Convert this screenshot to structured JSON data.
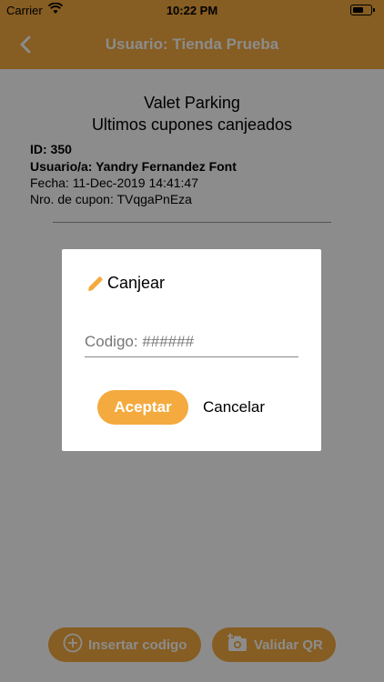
{
  "status_bar": {
    "carrier": "Carrier",
    "time": "10:22 PM"
  },
  "nav": {
    "title": "Usuario: Tienda Prueba",
    "back_icon": "chevron-left-icon"
  },
  "content": {
    "heading": "Valet Parking",
    "subheading": "Ultimos cupones canjeados",
    "coupon": {
      "id": "ID: 350",
      "user": "Usuario/a: Yandry Fernandez Font",
      "date": "Fecha: 11-Dec-2019 14:41:47",
      "code": "Nro. de cupon: TVqgaPnEza"
    }
  },
  "bottom_buttons": {
    "insert_label": "Insertar codigo",
    "qr_label": "Validar QR"
  },
  "dialog": {
    "title": "Canjear",
    "input_placeholder": "Codigo: ######",
    "accept_label": "Aceptar",
    "cancel_label": "Cancelar"
  },
  "colors": {
    "accent": "#f4aa3e",
    "overlay": "rgba(0,0,0,0.45)"
  }
}
